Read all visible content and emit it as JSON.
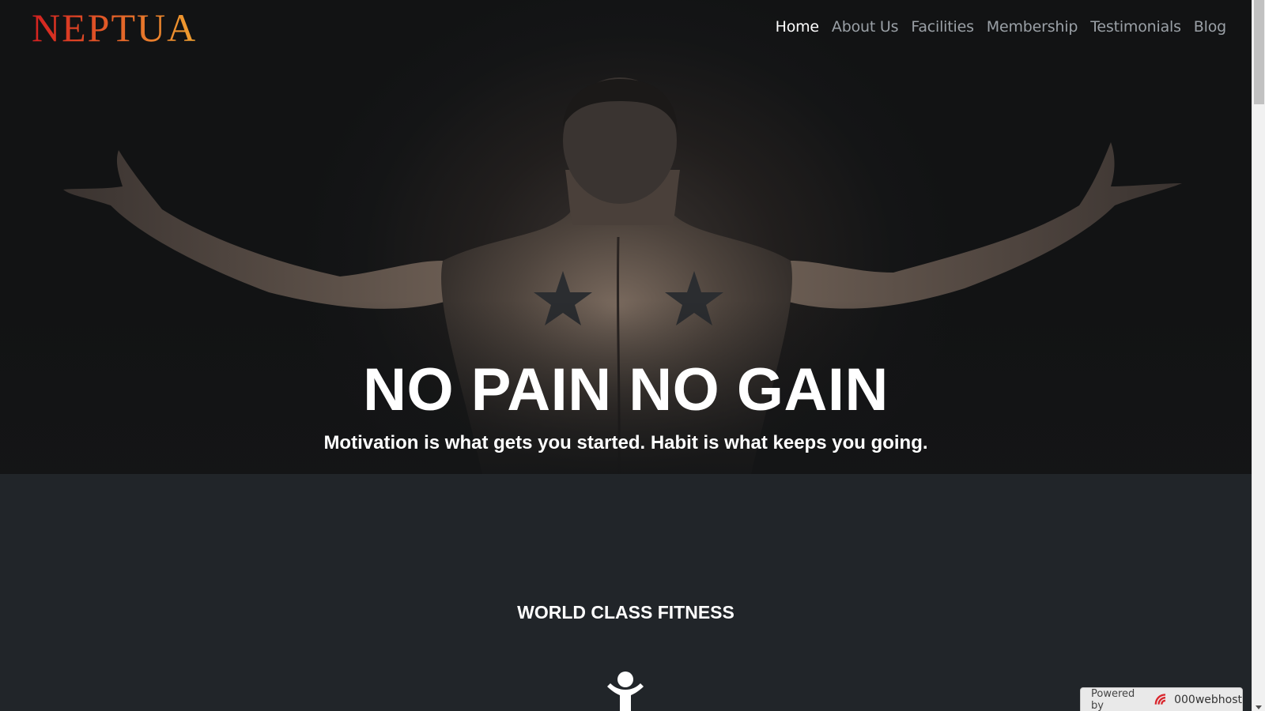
{
  "brand": {
    "logo_text": "NEPTUA",
    "logo_colors": {
      "start": "#d42020",
      "end": "#f0a030"
    }
  },
  "nav": {
    "items": [
      {
        "label": "Home",
        "active": true
      },
      {
        "label": "About Us",
        "active": false
      },
      {
        "label": "Facilities",
        "active": false
      },
      {
        "label": "Membership",
        "active": false
      },
      {
        "label": "Testimonials",
        "active": false
      },
      {
        "label": "Blog",
        "active": false
      }
    ]
  },
  "hero": {
    "title": "NO PAIN NO GAIN",
    "subtitle": "Motivation is what gets you started. Habit is what keeps you going."
  },
  "section": {
    "title": "WORLD CLASS FITNESS",
    "icon": "person-icon"
  },
  "footer_badge": {
    "label": "Powered by",
    "brand": "000webhost",
    "icon": "000webhost-logo-icon"
  },
  "colors": {
    "hero_bg": "#131415",
    "section_bg": "#212529",
    "nav_active": "#ffffff",
    "nav_inactive": "#9aa0a6"
  }
}
